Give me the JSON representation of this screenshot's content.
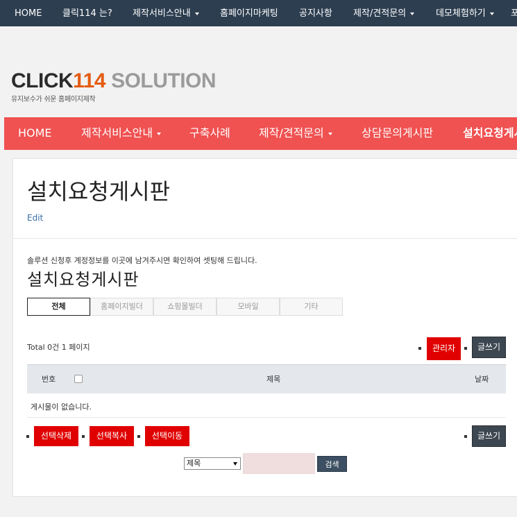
{
  "topnav": {
    "items": [
      {
        "label": "HOME",
        "dropdown": false
      },
      {
        "label": "클릭114 는?",
        "dropdown": false
      },
      {
        "label": "제작서비스안내",
        "dropdown": true
      },
      {
        "label": "홈페이지마케팅",
        "dropdown": false
      },
      {
        "label": "공지사항",
        "dropdown": false
      },
      {
        "label": "제작/견적문의",
        "dropdown": true
      },
      {
        "label": "데모체험하기",
        "dropdown": true
      },
      {
        "label": "포",
        "dropdown": false
      }
    ]
  },
  "logo": {
    "part1": "CLICK",
    "part2": "114",
    "part3": "SOLUTION",
    "tagline": "유지보수가 쉬운 홈페이지제작"
  },
  "mainnav": {
    "items": [
      {
        "label": "HOME",
        "dropdown": false
      },
      {
        "label": "제작서비스안내",
        "dropdown": true
      },
      {
        "label": "구축사례",
        "dropdown": false
      },
      {
        "label": "제작/견적문의",
        "dropdown": true
      },
      {
        "label": "상담문의게시판",
        "dropdown": false
      },
      {
        "label": "설치요청게시판",
        "dropdown": false,
        "active": true
      }
    ]
  },
  "page": {
    "title": "설치요청게시판",
    "edit_label": "Edit"
  },
  "board": {
    "notice": "솔루션 신청후 계정정보를 이곳에 남겨주시면 확인하여 셋팅해 드립니다.",
    "title": "설치요청게시판",
    "categories": [
      "전체",
      "홈페이지빌더",
      "쇼핑몰빌더",
      "모바일",
      "기타"
    ],
    "active_category": "전체",
    "total_text": "Total 0건 1 페이지",
    "admin_button": "관리자",
    "write_button": "글쓰기",
    "columns": {
      "number": "번호",
      "subject": "제목",
      "date": "날짜"
    },
    "empty_message": "게시물이 없습니다.",
    "bulk_actions": {
      "delete": "선택삭제",
      "copy": "선택복사",
      "move": "선택이동"
    },
    "search": {
      "field_selected": "제목",
      "query": "",
      "button": "검색"
    }
  },
  "colors": {
    "topbar": "#2d3e50",
    "mainnav": "#f05151",
    "button_red": "#e00000",
    "button_dark": "#3d4751",
    "logo_accent": "#e45b12"
  }
}
